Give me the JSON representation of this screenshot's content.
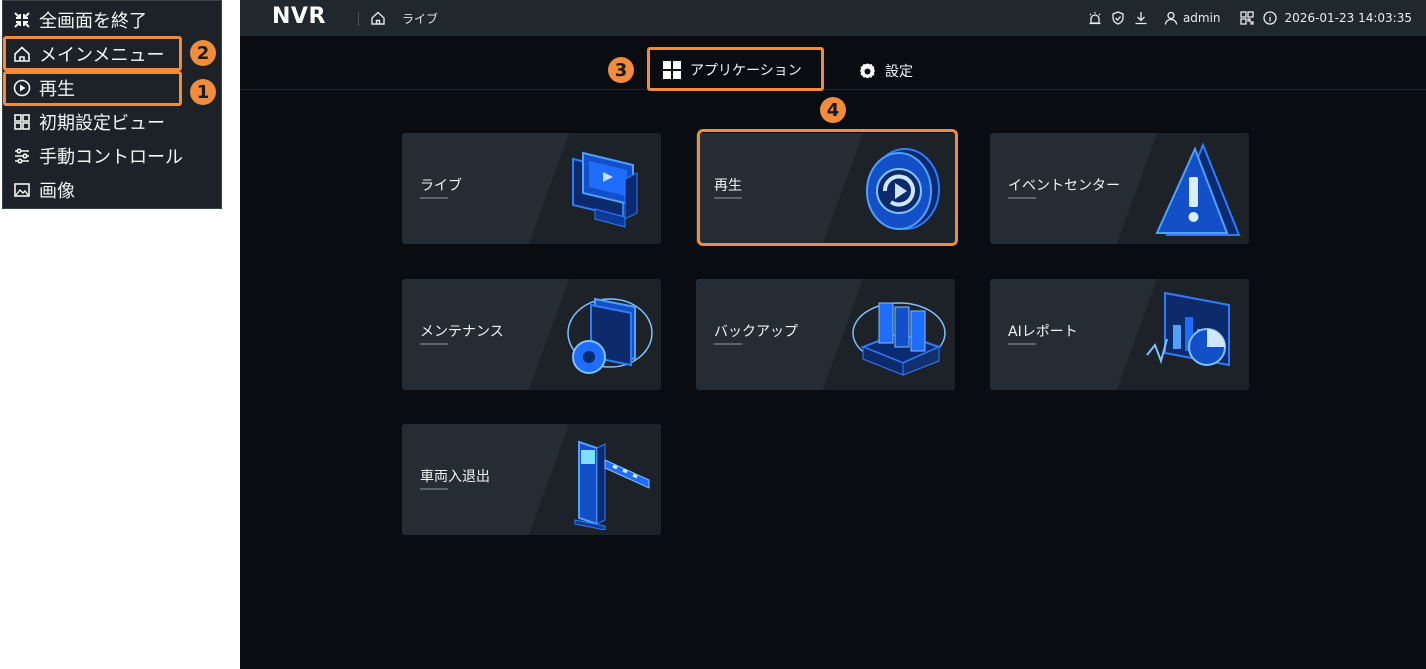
{
  "context_menu": {
    "items": [
      {
        "label": "全画面を終了",
        "icon": "exit-fullscreen-icon"
      },
      {
        "label": "メインメニュー",
        "icon": "home-icon"
      },
      {
        "label": "再生",
        "icon": "play-circle-icon"
      },
      {
        "label": "初期設定ビュー",
        "icon": "grid-view-icon"
      },
      {
        "label": "手動コントロール",
        "icon": "sliders-icon"
      },
      {
        "label": "画像",
        "icon": "image-icon"
      }
    ]
  },
  "callouts": {
    "one": "1",
    "two": "2",
    "three": "3",
    "four": "4"
  },
  "topbar": {
    "app_name": "NVR",
    "breadcrumb": "ライブ",
    "user": "admin",
    "datetime": "2026-01-23 14:03:35"
  },
  "tabs": {
    "applications": "アプリケーション",
    "settings": "設定"
  },
  "apps": [
    {
      "label": "ライブ",
      "icon": "monitor-icon"
    },
    {
      "label": "再生",
      "icon": "playback-icon"
    },
    {
      "label": "イベントセンター",
      "icon": "alert-triangle-icon"
    },
    {
      "label": "メンテナンス",
      "icon": "maintenance-gear-icon"
    },
    {
      "label": "バックアップ",
      "icon": "backup-drive-icon"
    },
    {
      "label": "AIレポート",
      "icon": "ai-report-chart-icon"
    },
    {
      "label": "車両入退出",
      "icon": "vehicle-barrier-icon"
    }
  ],
  "colors": {
    "highlight": "#f08c3c",
    "accent_blue": "#2f7bff",
    "window_bg": "#090d11",
    "card_bg": "#252c33"
  }
}
